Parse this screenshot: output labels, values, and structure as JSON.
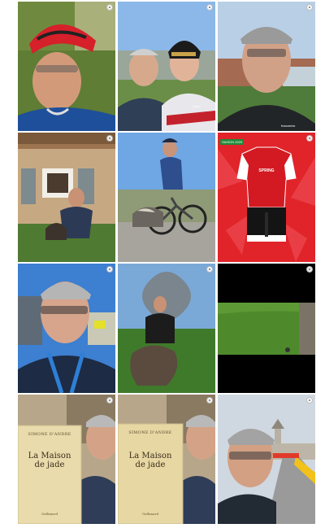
{
  "grid": {
    "tiles": [
      {
        "name": "selfie-helmet",
        "kind": "photo"
      },
      {
        "name": "selfie-with-rider",
        "kind": "photo",
        "shirt_text": "Sport"
      },
      {
        "name": "selfie-building",
        "kind": "photo",
        "shirt_text": "francemix"
      },
      {
        "name": "man-with-dog-house",
        "kind": "photo"
      },
      {
        "name": "cyclist-with-dog",
        "kind": "photo"
      },
      {
        "name": "team-jersey",
        "kind": "graphic",
        "tag_text": "SAISON 2025",
        "brand_text": "SPRING"
      },
      {
        "name": "selfie-lanyard",
        "kind": "photo"
      },
      {
        "name": "man-with-dog-garden",
        "kind": "photo"
      },
      {
        "name": "grass-video",
        "kind": "video"
      },
      {
        "name": "book-selfie-1",
        "kind": "photo",
        "book": {
          "author": "SIMONE D'ANDRE",
          "title_line1": "La Maison",
          "title_line2": "de jade",
          "publisher": "Gallimard"
        }
      },
      {
        "name": "book-selfie-2",
        "kind": "photo",
        "book": {
          "author": "SIMONE D'ANDRE",
          "title_line1": "La Maison",
          "title_line2": "de jade",
          "publisher": "Gallimard"
        }
      },
      {
        "name": "selfie-race-barriers",
        "kind": "photo"
      }
    ]
  },
  "colors": {
    "jersey_red": "#e0242a",
    "sky_blue": "#8bb8e8",
    "grass_green": "#4e8a2c"
  }
}
